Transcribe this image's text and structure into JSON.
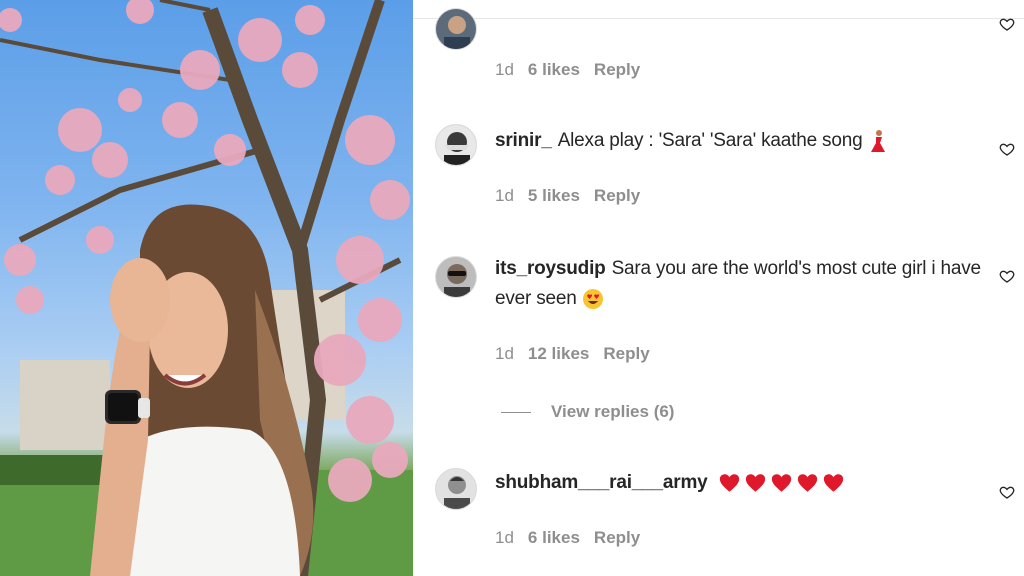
{
  "comments": [
    {
      "username": "",
      "text": "",
      "time": "1d",
      "likes": "6 likes",
      "reply": "Reply"
    },
    {
      "username": "srinir_",
      "text": "Alexa play : 'Sara' 'Sara' kaathe song",
      "time": "1d",
      "likes": "5 likes",
      "reply": "Reply"
    },
    {
      "username": "its_roysudip",
      "text": "Sara you are the world's most cute girl i have ever seen",
      "time": "1d",
      "likes": "12 likes",
      "reply": "Reply"
    },
    {
      "username": "shubham___rai___army",
      "text": "",
      "time": "1d",
      "likes": "6 likes",
      "reply": "Reply"
    }
  ],
  "view_replies": "View replies (6)",
  "icons": {
    "like": "heart-outline-icon",
    "dancer": "dancer-emoji",
    "heart_eyes": "heart-eyes-emoji",
    "red_heart": "red-heart-emoji"
  },
  "colors": {
    "username": "#262626",
    "meta": "#8e8e8e",
    "red_heart": "#e0182c"
  }
}
